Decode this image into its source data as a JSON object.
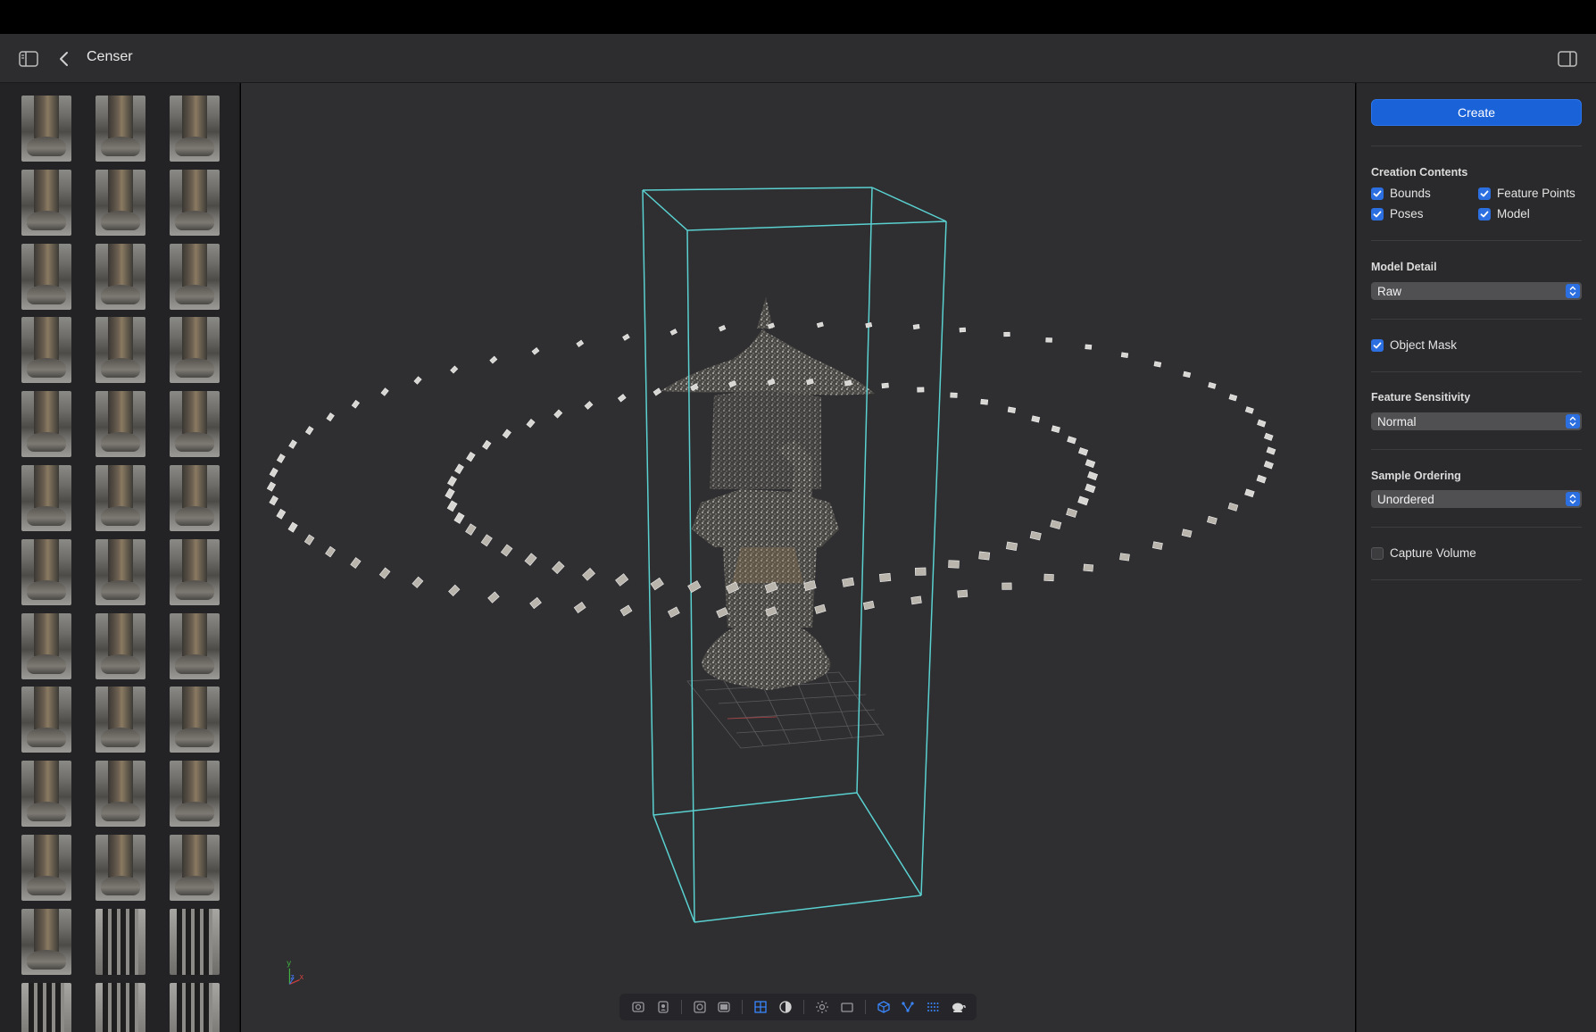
{
  "window": {
    "title": "Censer"
  },
  "sidebar": {
    "rows": 13,
    "cols": 3
  },
  "inspector": {
    "create_label": "Create",
    "creation_contents": {
      "title": "Creation Contents",
      "bounds": "Bounds",
      "feature_points": "Feature Points",
      "poses": "Poses",
      "model": "Model"
    },
    "model_detail": {
      "title": "Model Detail",
      "value": "Raw"
    },
    "object_mask": "Object Mask",
    "feature_sensitivity": {
      "title": "Feature Sensitivity",
      "value": "Normal"
    },
    "sample_ordering": {
      "title": "Sample Ordering",
      "value": "Unordered"
    },
    "capture_volume": "Capture Volume"
  },
  "viewport": {
    "axis_labels": {
      "y": "y",
      "z": "z",
      "x": "x"
    }
  },
  "colors": {
    "accent": "#1a62d8",
    "bounds": "#5ad0d0"
  }
}
